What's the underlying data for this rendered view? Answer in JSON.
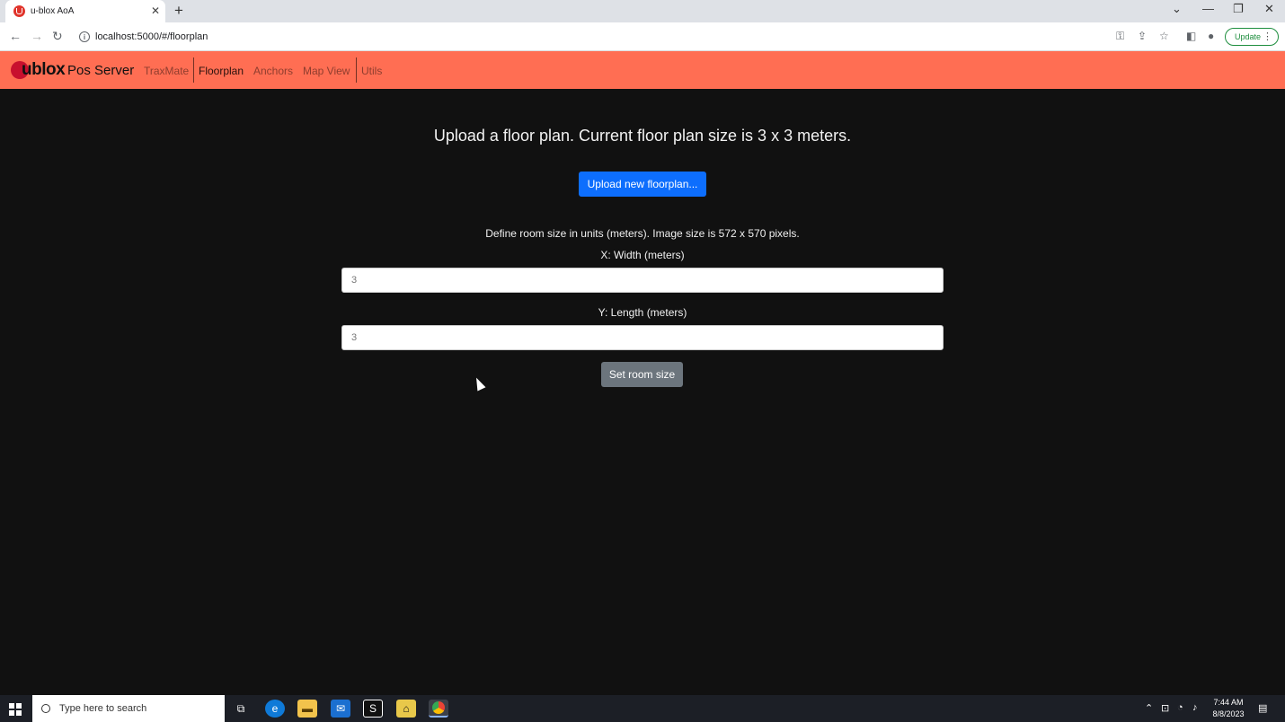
{
  "browser": {
    "tab_title": "u-blox AoA",
    "tab_close": "✕",
    "new_tab": "+",
    "url": "localhost:5000/#/floorplan",
    "update_label": "Update",
    "window_controls": [
      "⌄",
      "—",
      "❐",
      "✕"
    ]
  },
  "app": {
    "brand": "ublox",
    "brand_sub": "Pos Server",
    "nav": [
      {
        "label": "TraxMate",
        "active": false
      },
      {
        "label": "Floorplan",
        "active": true
      },
      {
        "label": "Anchors",
        "active": false
      },
      {
        "label": "Map View",
        "active": false
      },
      {
        "label": "Utils",
        "active": false
      }
    ]
  },
  "main": {
    "headline": "Upload a floor plan. Current floor plan size is 3 x 3 meters.",
    "upload_button": "Upload new floorplan...",
    "description": "Define room size in units (meters). Image size is 572 x 570 pixels.",
    "width_label": "X: Width (meters)",
    "width_value": "3",
    "length_label": "Y: Length (meters)",
    "length_value": "3",
    "set_button": "Set room size"
  },
  "taskbar": {
    "search_placeholder": "Type here to search",
    "time": "7:44 AM",
    "date": "8/8/2023"
  },
  "colors": {
    "navbar": "#ff6e53",
    "primary": "#0d6efd",
    "secondary": "#6c757d",
    "background": "#111111"
  }
}
